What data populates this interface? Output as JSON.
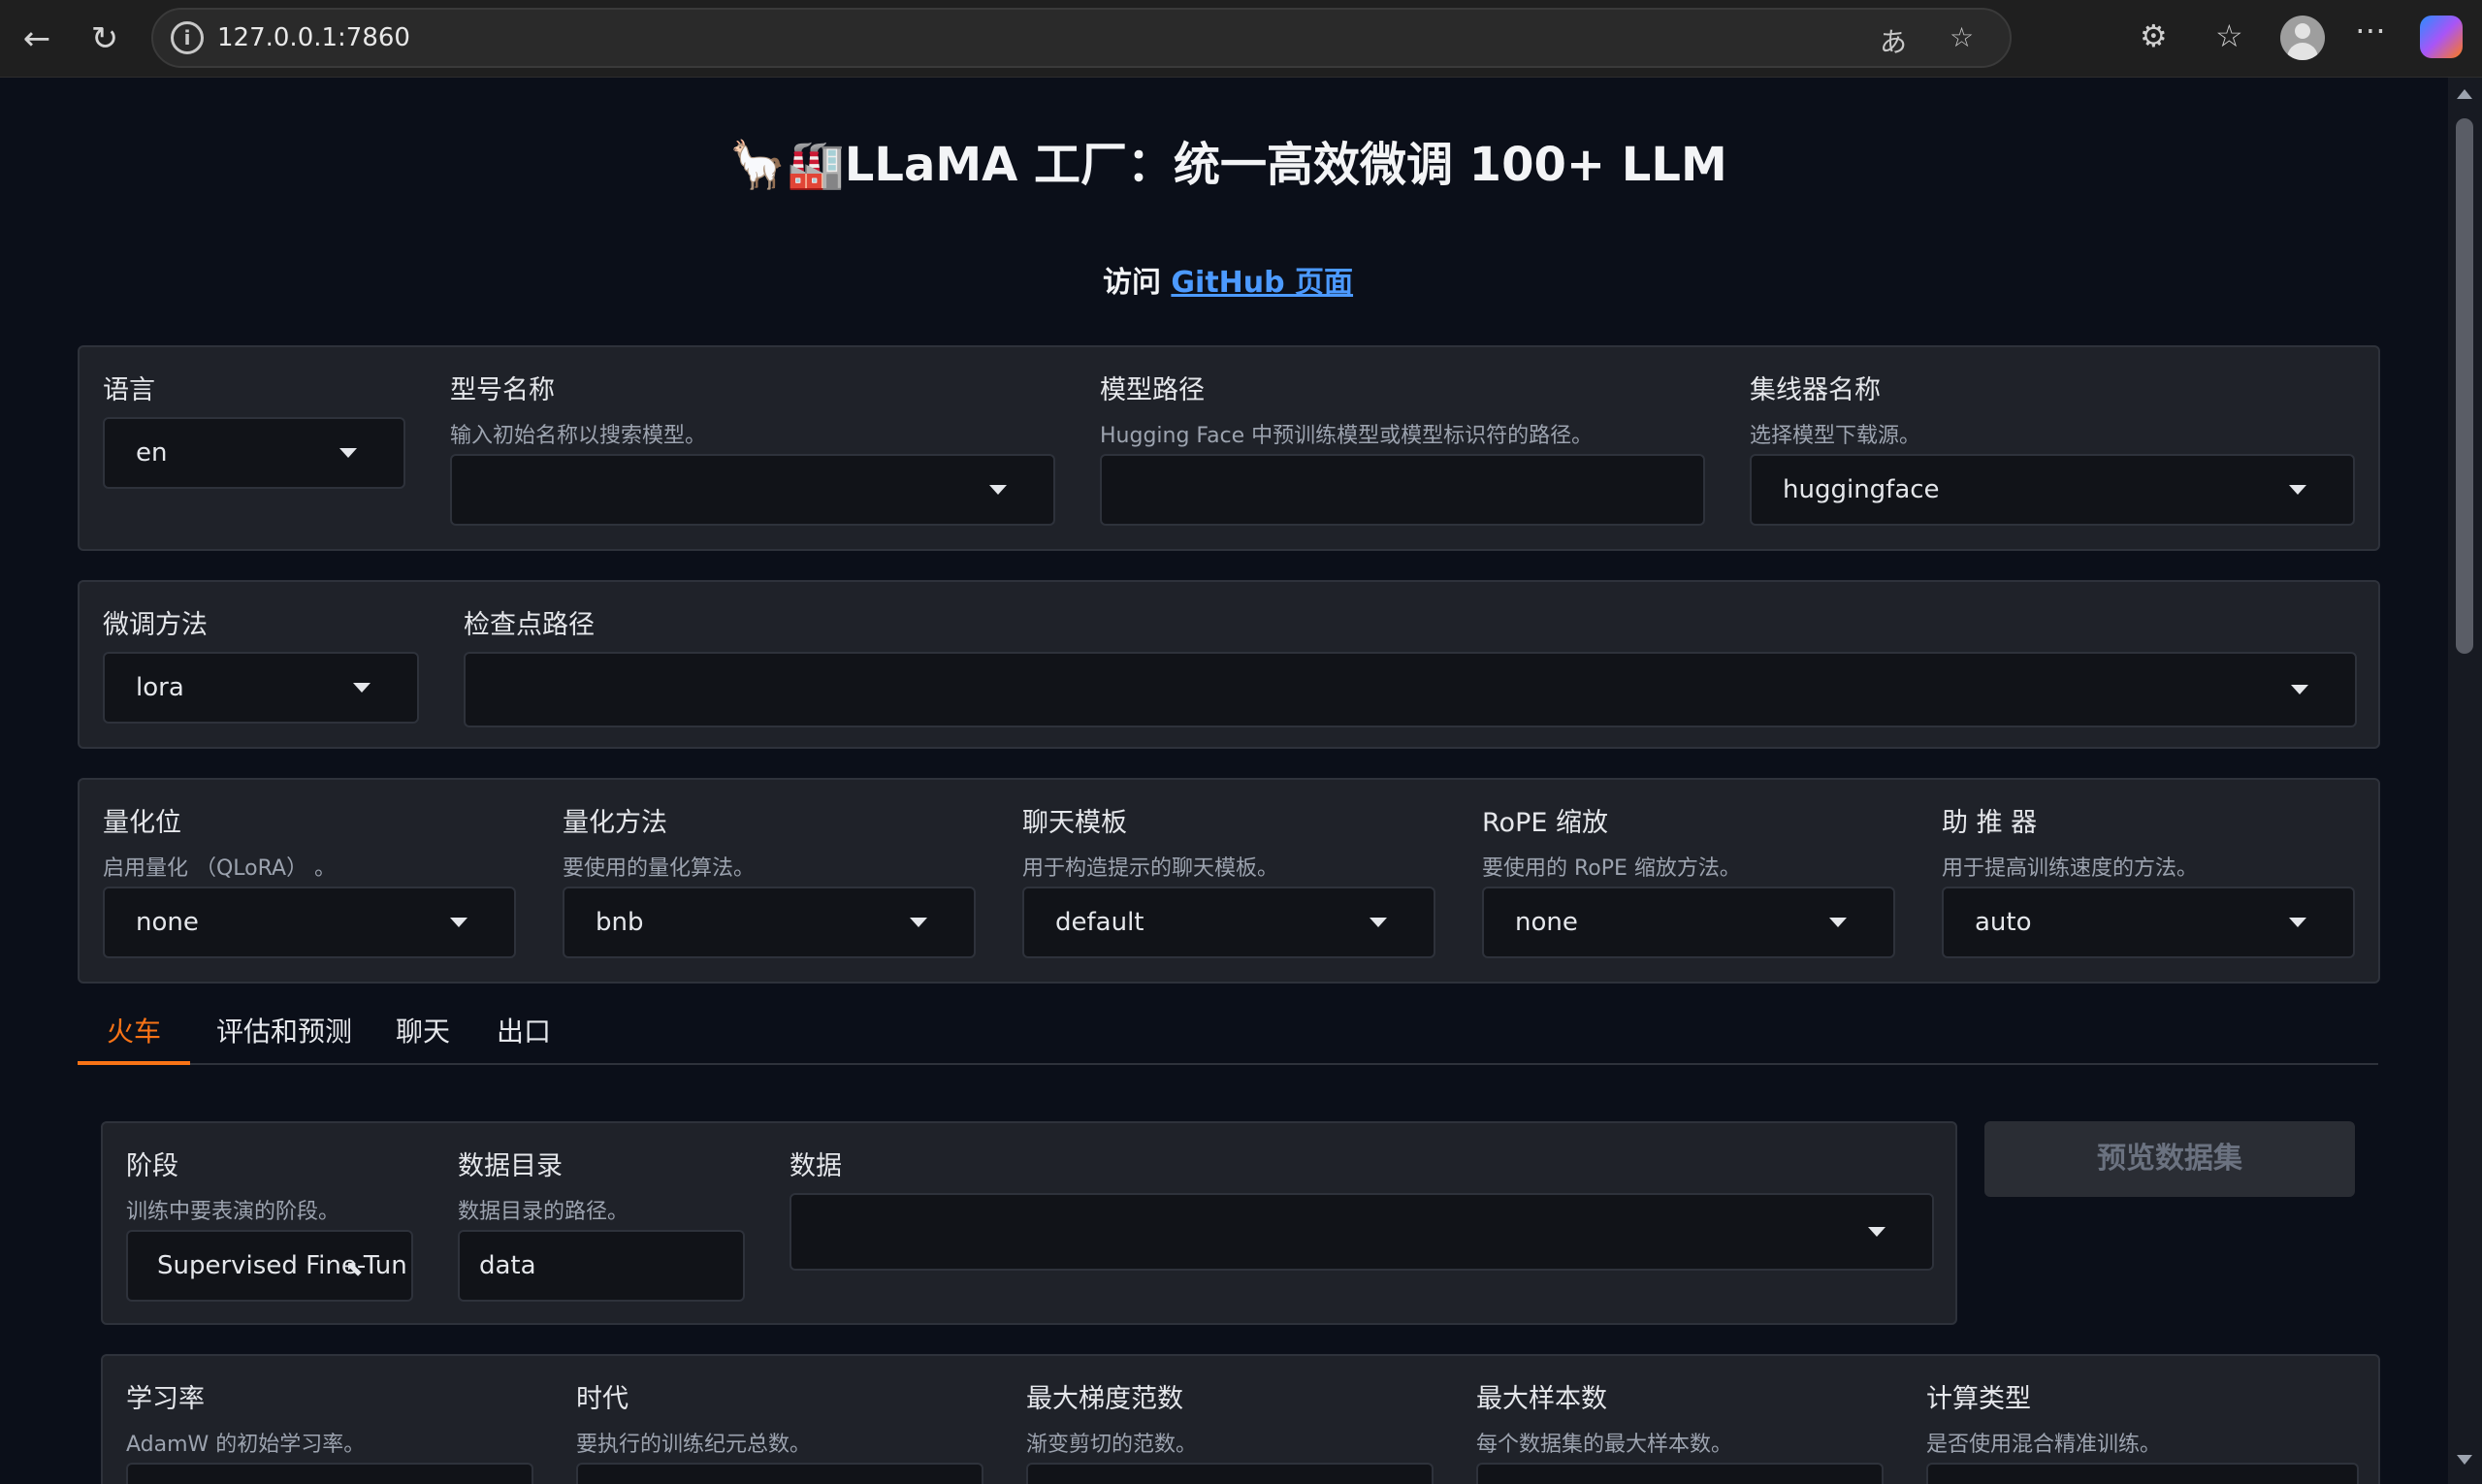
{
  "browser": {
    "url": "127.0.0.1:7860"
  },
  "header": {
    "title": "🦙🏭LLaMA 工厂：统一高效微调 100+ LLM",
    "subtitle_prefix": "访问 ",
    "subtitle_link": "GitHub 页面"
  },
  "row1": {
    "language": {
      "label": "语言",
      "value": "en"
    },
    "model_name": {
      "label": "型号名称",
      "info": "输入初始名称以搜索模型。",
      "value": ""
    },
    "model_path": {
      "label": "模型路径",
      "info": "Hugging Face 中预训练模型或模型标识符的路径。",
      "value": ""
    },
    "hub_name": {
      "label": "集线器名称",
      "info": "选择模型下载源。",
      "value": "huggingface"
    }
  },
  "row2": {
    "finetune_method": {
      "label": "微调方法",
      "value": "lora"
    },
    "checkpoint_path": {
      "label": "检查点路径",
      "value": ""
    }
  },
  "row3": {
    "quant_bit": {
      "label": "量化位",
      "info": "启用量化 （QLoRA） 。",
      "value": "none"
    },
    "quant_method": {
      "label": "量化方法",
      "info": "要使用的量化算法。",
      "value": "bnb"
    },
    "template": {
      "label": "聊天模板",
      "info": "用于构造提示的聊天模板。",
      "value": "default"
    },
    "rope_scaling": {
      "label": "RoPE 缩放",
      "info": "要使用的 RoPE 缩放方法。",
      "value": "none"
    },
    "booster": {
      "label": "助 推 器",
      "info": "用于提高训练速度的方法。",
      "value": "auto"
    }
  },
  "tabs": [
    {
      "label": "火车",
      "active": true
    },
    {
      "label": "评估和预测",
      "active": false
    },
    {
      "label": "聊天",
      "active": false
    },
    {
      "label": "出口",
      "active": false
    }
  ],
  "train": {
    "stage": {
      "label": "阶段",
      "info": "训练中要表演的阶段。",
      "value": "Supervised Fine-Tun"
    },
    "dataset_dir": {
      "label": "数据目录",
      "info": "数据目录的路径。",
      "value": "data"
    },
    "dataset": {
      "label": "数据",
      "value": ""
    },
    "preview_button": "预览数据集",
    "learning_rate": {
      "label": "学习率",
      "info": "AdamW 的初始学习率。"
    },
    "epochs": {
      "label": "时代",
      "info": "要执行的训练纪元总数。"
    },
    "max_grad_norm": {
      "label": "最大梯度范数",
      "info": "渐变剪切的范数。"
    },
    "max_samples": {
      "label": "最大样本数",
      "info": "每个数据集的最大样本数。"
    },
    "compute_type": {
      "label": "计算类型",
      "info": "是否使用混合精准训练。"
    }
  }
}
